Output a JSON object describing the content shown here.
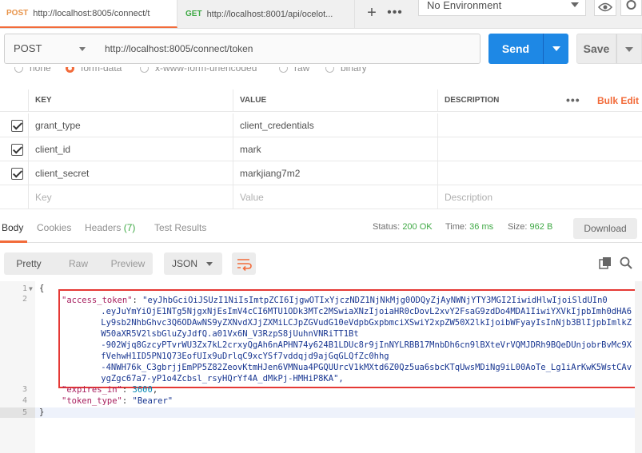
{
  "tabs": [
    {
      "method": "POST",
      "url": "http://localhost:8005/connect/t"
    },
    {
      "method": "GET",
      "url": "http://localhost:8001/api/ocelot..."
    }
  ],
  "environment": "No Environment",
  "request": {
    "method": "POST",
    "url": "http://localhost:8005/connect/token",
    "send_label": "Send",
    "save_label": "Save"
  },
  "body_types": [
    "none",
    "form-data",
    "x-www-form-urlencoded",
    "raw",
    "binary"
  ],
  "params": {
    "headers": [
      "KEY",
      "VALUE",
      "DESCRIPTION"
    ],
    "bulk_edit": "Bulk Edit",
    "rows": [
      {
        "key": "grant_type",
        "value": "client_credentials",
        "description": ""
      },
      {
        "key": "client_id",
        "value": "mark",
        "description": ""
      },
      {
        "key": "client_secret",
        "value": "markjiang7m2",
        "description": ""
      }
    ],
    "placeholders": {
      "key": "Key",
      "value": "Value",
      "description": "Description"
    }
  },
  "response": {
    "tabs": {
      "body": "Body",
      "cookies": "Cookies",
      "headers": "Headers",
      "headers_count": "(7)",
      "tests": "Test Results"
    },
    "status_label": "Status:",
    "status": "200 OK",
    "time_label": "Time:",
    "time": "36 ms",
    "size_label": "Size:",
    "size": "962 B",
    "download_label": "Download",
    "views": [
      "Pretty",
      "Raw",
      "Preview"
    ],
    "format": "JSON"
  },
  "code": {
    "line_numbers": [
      "1",
      "2",
      "3",
      "4",
      "5"
    ],
    "open_brace": "{",
    "close_brace": "}",
    "access_token_key": "\"access_token\"",
    "token_lines": [
      "\"eyJhbGciOiJSUzI1NiIsImtpZCI6IjgwOTIxYjczNDZ1NjNkMjg0ODQyZjAyNWNjYTY3MGI2IiwidHlwIjoiSldUIn0",
      "    .eyJuYmYiOjE1NTg5NjgxNjEsImV4cCI6MTU1ODk3MTc2MSwiaXNzIjoiaHR0cDovL2xvY2FsaG9zdDo4MDA1IiwiYXVkIjpbImh0dHA6",
      "    Ly9sb2NhbGhvc3Q6ODAwNS9yZXNvdXJjZXMiLCJpZGVudG10eVdpbGxpbmciXSwiY2xpZW50X2lkIjoibWFyayIsInNjb3BlIjpbImlkZ",
      "    W50aXR5V2lsbGluZyJdfQ.a01Vx6N_V3RzpS8jUuhnVNRiTT1Bt",
      "    -902Wjq8GzcyPTvrWU3Zx7kL2crxyQgAh6nAPHN74y624B1LDUc8r9jInNYLRBB17MnbDh6cn9lBXteVrVQMJDRh9BQeDUnjobrBvMc9X",
      "    fVehwH1ID5PN1Q73EofUIx9uDrlqC9xcYSf7vddqjd9ajGqGLQfZc0hhg",
      "    -4NWH76k_C3gbrjjEmPP5Z82ZeovKtmHJen6VMNua4PGQUUrcV1kMXtd6Z0Qz5ua6sbcKTqUwsMDiNg9iL00AoTe_Lg1iArKwK5WstCAv",
      "    ygZgc67a7-yP1o4Zcbsl_rsyHQrYf4A_dMkPj-HMHiP8KA\","
    ],
    "expires_key": "\"expires_in\"",
    "expires_value": "3600",
    "token_type_key": "\"token_type\"",
    "token_type_value": "\"Bearer\""
  },
  "colors": {
    "accent": "#f26b3a",
    "send": "#1e88e5",
    "status_ok": "#3fa945",
    "highlight_box": "#e53935"
  },
  "icons": [
    "eye-icon",
    "gear-icon",
    "plus-icon",
    "more-icon",
    "wrap-icon",
    "copy-icon",
    "search-icon"
  ]
}
